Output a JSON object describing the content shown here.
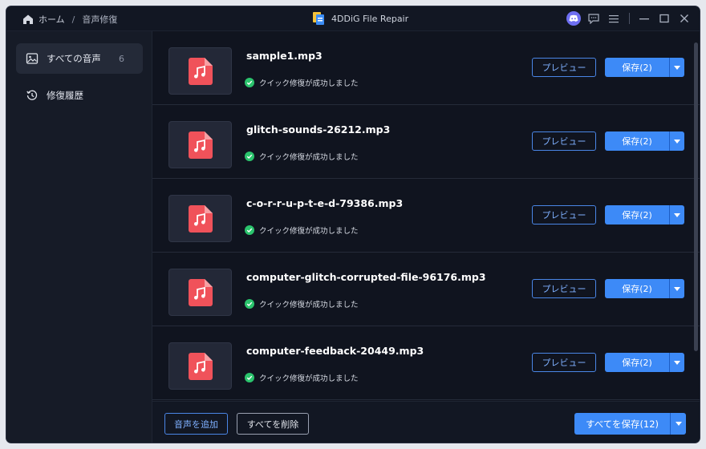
{
  "header": {
    "breadcrumb": [
      "ホーム",
      "音声修復"
    ],
    "separator": "/",
    "app_title": "4DDiG File Repair",
    "icons": [
      "home-icon",
      "app-logo-icon",
      "discord-icon",
      "feedback-icon",
      "menu-icon",
      "minimize-icon",
      "maximize-icon",
      "close-icon"
    ]
  },
  "sidebar": {
    "items": [
      {
        "label": "すべての音声",
        "count": "6",
        "icon": "image-icon",
        "active": true
      },
      {
        "label": "修復履歴",
        "icon": "history-icon",
        "active": false
      }
    ]
  },
  "files": [
    {
      "name": "sample1.mp3",
      "status": "クイック修復が成功しました"
    },
    {
      "name": "glitch-sounds-26212.mp3",
      "status": "クイック修復が成功しました"
    },
    {
      "name": "c-o-r-r-u-p-t-e-d-79386.mp3",
      "status": "クイック修復が成功しました"
    },
    {
      "name": "computer-glitch-corrupted-file-96176.mp3",
      "status": "クイック修復が成功しました"
    },
    {
      "name": "computer-feedback-20449.mp3",
      "status": "クイック修復が成功しました"
    }
  ],
  "row_actions": {
    "preview_label": "プレビュー",
    "save_label": "保存(2)"
  },
  "footer": {
    "add_label": "音声を追加",
    "delete_all_label": "すべてを削除",
    "save_all_label": "すべてを保存(12)"
  },
  "colors": {
    "accent": "#3d8af7",
    "file_icon": "#f0525a",
    "success": "#2bc46d",
    "background": "#10141f"
  }
}
